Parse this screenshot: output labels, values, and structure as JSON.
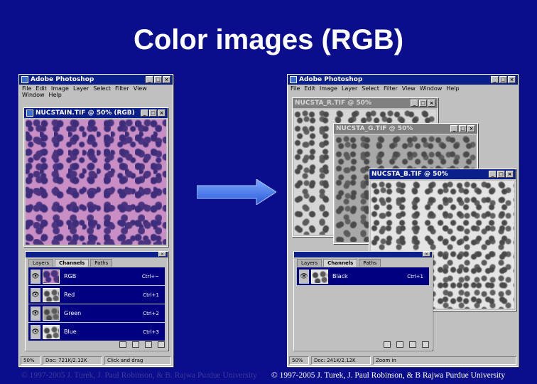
{
  "slide": {
    "title": "Color images (RGB)",
    "footer_left": "© 1997-2005 J. Turek, J. Paul Robinson, & B. Rajwa Purdue University",
    "footer_right": "© 1997-2005 J. Turek, J. Paul Robinson, & B Rajwa Purdue University"
  },
  "colors": {
    "background": "#0a0e8c",
    "titlebar": "#0a1f8a",
    "window": "#c0c0c0",
    "selection": "#000080"
  },
  "left_app": {
    "title": "Adobe Photoshop",
    "menu": [
      "File",
      "Edit",
      "Image",
      "Layer",
      "Select",
      "Filter",
      "View",
      "Window",
      "Help"
    ],
    "document": {
      "title": "NUCSTAIN.TIF @ 50% (RGB)"
    },
    "channels_panel": {
      "tabs": [
        "Layers",
        "Channels",
        "Paths"
      ],
      "channels": [
        {
          "name": "RGB",
          "shortcut": "Ctrl+~"
        },
        {
          "name": "Red",
          "shortcut": "Ctrl+1"
        },
        {
          "name": "Green",
          "shortcut": "Ctrl+2"
        },
        {
          "name": "Blue",
          "shortcut": "Ctrl+3"
        }
      ]
    },
    "status": {
      "zoom": "50%",
      "doc": "Doc: 721K/2.12K",
      "tool": "Click and drag"
    }
  },
  "right_app": {
    "title": "Adobe Photoshop",
    "menu": [
      "File",
      "Edit",
      "Image",
      "Layer",
      "Select",
      "Filter",
      "View",
      "Window",
      "Help"
    ],
    "documents": [
      {
        "title": "NUCSTA_R.TIF @ 50%"
      },
      {
        "title": "NUCSTA_G.TIF @ 50%"
      },
      {
        "title": "NUCSTA_B.TIF @ 50%"
      }
    ],
    "channels_panel": {
      "tabs": [
        "Layers",
        "Channels",
        "Paths"
      ],
      "channels": [
        {
          "name": "Black",
          "shortcut": "Ctrl+1"
        }
      ]
    },
    "status": {
      "zoom": "50%",
      "doc": "Doc: 241K/2.12K",
      "tool": "Zoom in"
    }
  },
  "icons": [
    "photoshop-icon",
    "minimize-icon",
    "maximize-icon",
    "close-icon",
    "eye-icon",
    "arrow-right-icon"
  ]
}
